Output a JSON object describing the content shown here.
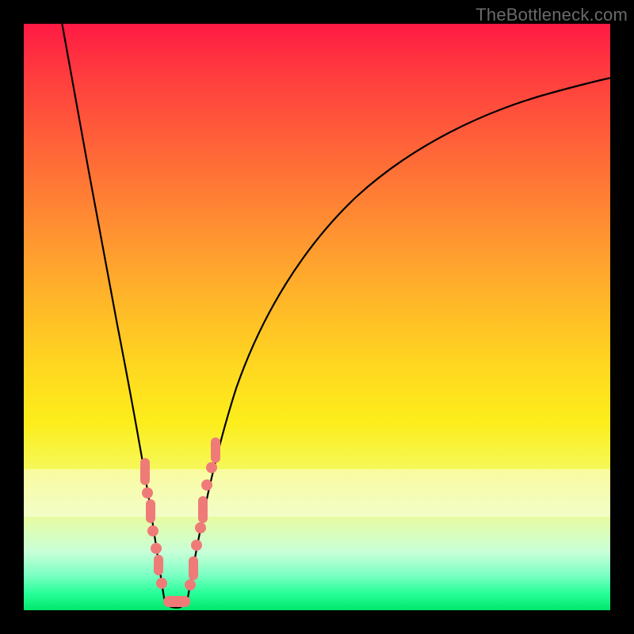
{
  "watermark": "TheBottleneck.com",
  "colors": {
    "marker": "#ef7b78",
    "curve": "#000000",
    "frame_bg_top": "#ff1a44",
    "frame_bg_bottom": "#00e66b",
    "page_bg": "#000000"
  },
  "chart_data": {
    "type": "line",
    "title": "",
    "xlabel": "",
    "ylabel": "",
    "xlim": [
      0,
      100
    ],
    "ylim": [
      0,
      100
    ],
    "grid": false,
    "legend": false,
    "note": "V-shaped bottleneck curve on rainbow heat background; no numeric axes shown. Values below are approximate pixel-space readings mapped to 0-100.",
    "series": [
      {
        "name": "bottleneck-curve",
        "x": [
          6,
          8,
          10,
          12,
          14,
          16,
          18,
          19,
          20,
          21,
          22,
          23,
          24,
          25,
          26,
          28,
          30,
          33,
          36,
          40,
          45,
          50,
          56,
          62,
          70,
          78,
          86,
          94,
          100
        ],
        "y": [
          100,
          90,
          80,
          70,
          60,
          48,
          34,
          24,
          14,
          6,
          1,
          0,
          0,
          1,
          4,
          12,
          22,
          34,
          44,
          54,
          62,
          68,
          74,
          78,
          82,
          85,
          87,
          89,
          90
        ]
      }
    ],
    "markers": {
      "name": "highlighted-data-points",
      "color": "#ef7b78",
      "x": [
        18.0,
        18.5,
        19.0,
        19.8,
        20.4,
        21.0,
        21.6,
        22.2,
        22.8,
        23.5,
        24.2,
        24.8,
        25.5,
        26.2,
        26.8,
        27.4,
        28.2,
        29.0,
        30.0
      ],
      "y": [
        34,
        29,
        24,
        17,
        11,
        6,
        3,
        1,
        0,
        0,
        0,
        1,
        3,
        6,
        10,
        14,
        19,
        25,
        31
      ]
    }
  }
}
